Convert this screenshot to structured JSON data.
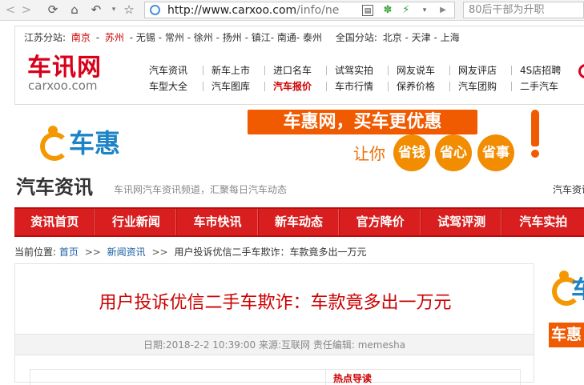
{
  "browser": {
    "url_host": "http://www.carxoo.com",
    "url_path": "/info/ne",
    "search_text": "80后干部为升职"
  },
  "branches": {
    "label": "江苏分站:",
    "items": [
      {
        "text": "南京",
        "active": true
      },
      {
        "text": "-",
        "active": false
      },
      {
        "text": "苏州",
        "active": true
      },
      {
        "text": "- 无锡 - 常州 - 徐州 - 扬州 - 镇江- 南通- 泰州",
        "active": false
      }
    ],
    "national_label": "全国分站:",
    "national": "北京 - 天津 - 上海"
  },
  "logo": {
    "cn": "车讯网",
    "en": "carxoo.com"
  },
  "nav": {
    "row1": [
      "汽车资讯",
      "新车上市",
      "进口名车",
      "试驾实拍",
      "网友说车",
      "网友评店",
      "4S店招聘"
    ],
    "row2": [
      "车型大全",
      "汽车图库",
      "汽车报价",
      "车市行情",
      "保养价格",
      "汽车团购",
      "二手汽车"
    ],
    "highlight": "汽车报价"
  },
  "banner": {
    "logo_text": "车惠",
    "promo": "车惠网，买车更优惠",
    "rangni": "让你",
    "circles": [
      "省钱",
      "省心",
      "省事"
    ]
  },
  "section": {
    "title": "汽车资讯",
    "subtitle": "车讯网汽车资讯频道，汇聚每日汽车动态",
    "right": "汽车资讯"
  },
  "menu": [
    "资讯首页",
    "行业新闻",
    "车市快讯",
    "新车动态",
    "官方降价",
    "试驾评测",
    "汽车实拍"
  ],
  "breadcrumb": {
    "label": "当前位置:",
    "home": "首页",
    "sep": ">>",
    "section": "新闻资讯",
    "current": "用户投诉优信二手车欺诈：车款竟多出一万元"
  },
  "article": {
    "title": "用户投诉优信二手车欺诈：车款竟多出一万元",
    "meta": "日期:2018-2-2 10:39:00   来源:互联网   责任编辑: memesha",
    "hot_label": "热点导读"
  },
  "side_ad": {
    "logo_text": "车",
    "promo": "车惠"
  },
  "colors": {
    "brand_red": "#d8001a",
    "menu_red": "#d81e1e",
    "orange": "#f05a00",
    "chehui_blue": "#1c84c6"
  }
}
